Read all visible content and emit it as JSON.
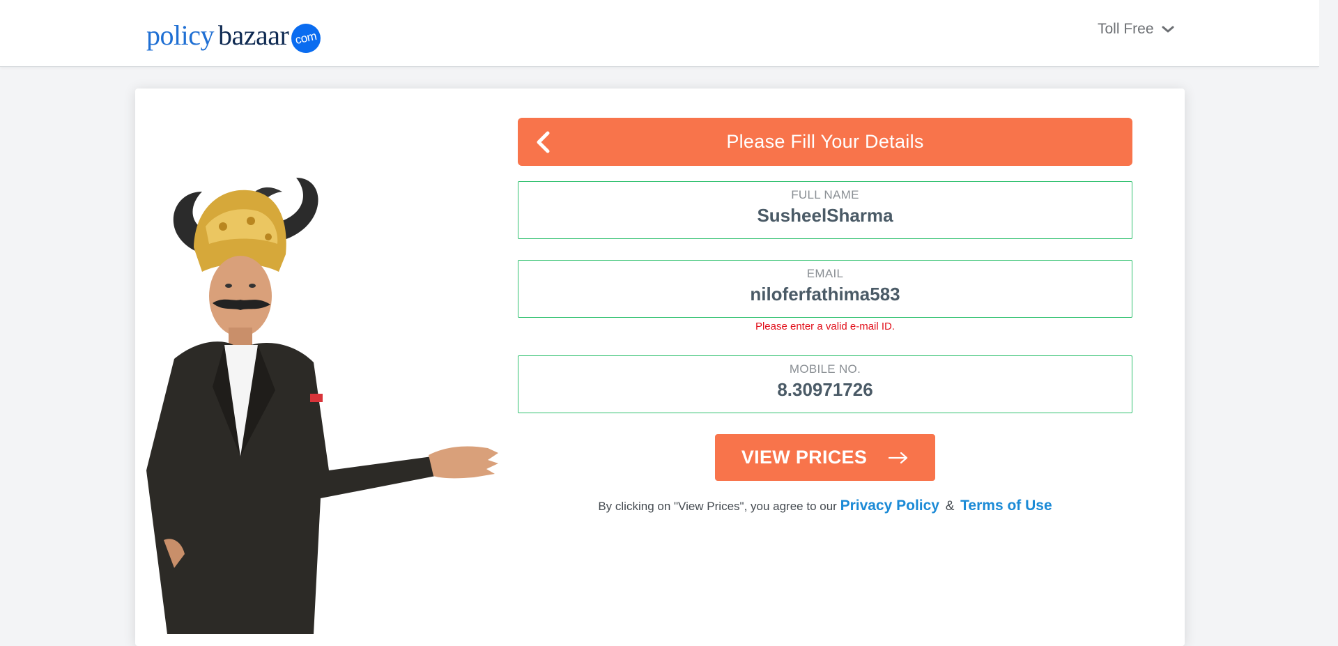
{
  "header": {
    "logo_policy": "policy",
    "logo_bazaar": "bazaar",
    "logo_dotcom": "com",
    "tollfree_label": "Toll Free"
  },
  "form": {
    "title": "Please Fill Your Details",
    "fields": {
      "full_name": {
        "label": "FULL NAME",
        "value": "SusheelSharma"
      },
      "email": {
        "label": "EMAIL",
        "value": "niloferfathima583",
        "error": "Please enter a valid e-mail ID."
      },
      "mobile": {
        "label": "MOBILE NO.",
        "value": "8.30971726"
      }
    },
    "cta_label": "VIEW PRICES",
    "agree_prefix": "By clicking on \"View Prices\", you agree to our",
    "privacy_link": "Privacy Policy",
    "amp": "&",
    "terms_link": "Terms of Use"
  },
  "colors": {
    "accent": "#f8744b",
    "field_border": "#2fc06e",
    "error": "#e10f1a",
    "link": "#1b8ad6"
  },
  "icons": {
    "back": "chevron-left-icon",
    "tollfree": "chevron-down-icon",
    "cta": "arrow-right-icon"
  }
}
